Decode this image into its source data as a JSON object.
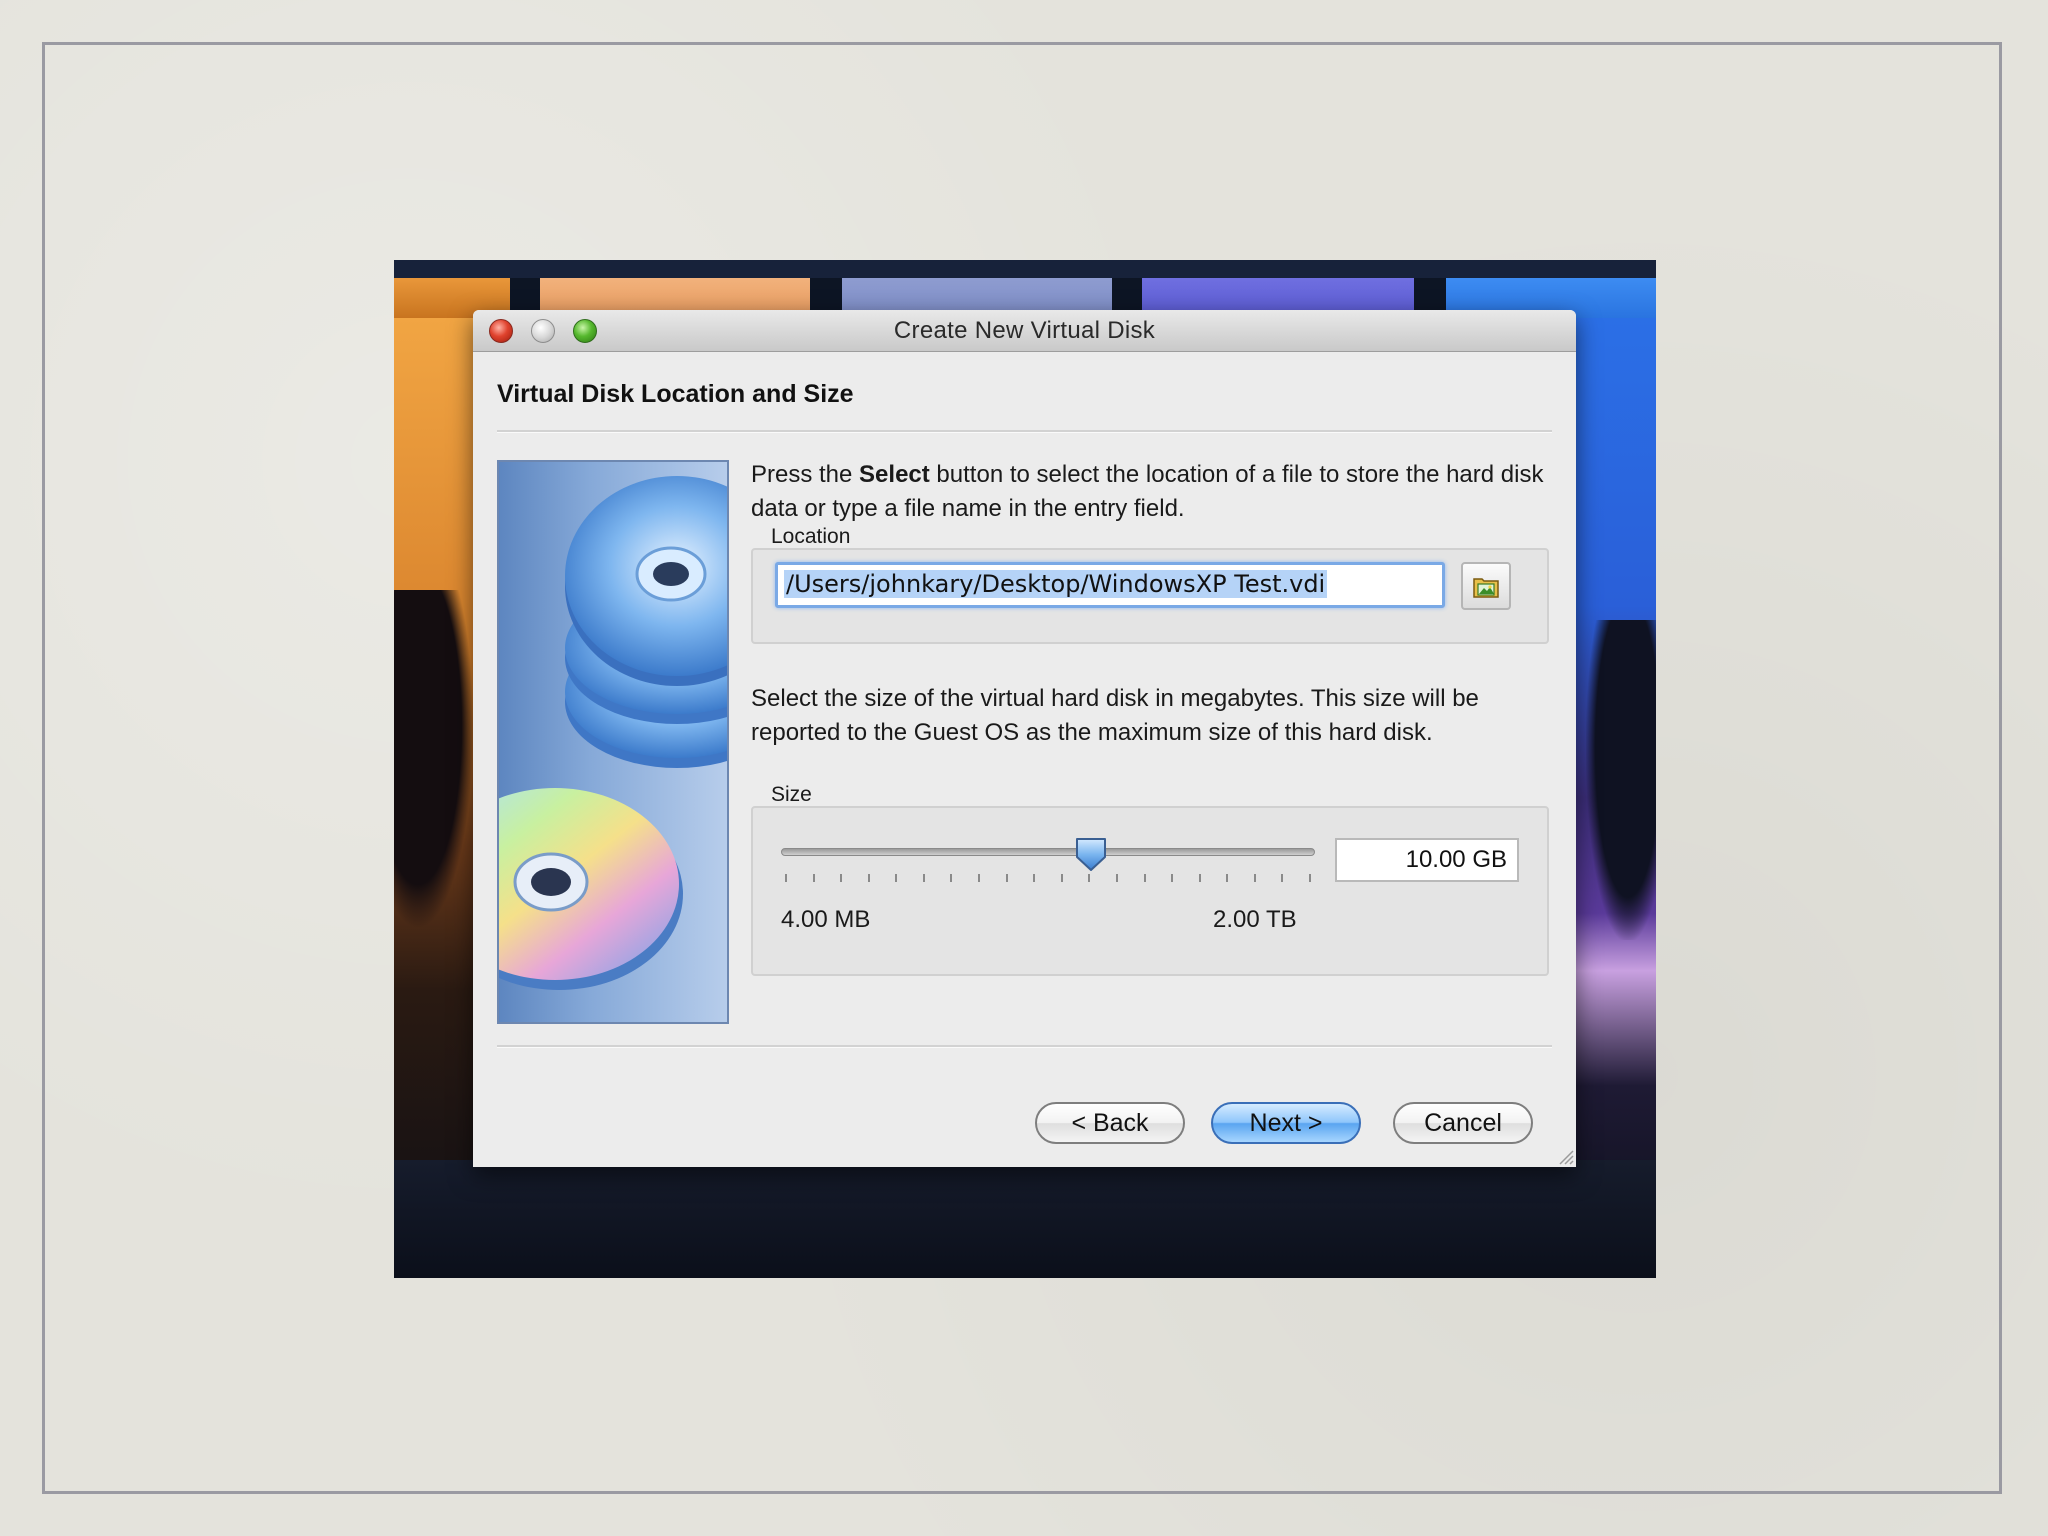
{
  "window": {
    "title": "Create New Virtual Disk"
  },
  "page": {
    "title": "Virtual Disk Location and Size"
  },
  "location": {
    "instruction_pre": "Press the ",
    "instruction_bold": "Select",
    "instruction_post": " button to select the location of a file to store the hard disk data or type a file name in the entry field.",
    "group_label": "Location",
    "path_value": "/Users/johnkary/Desktop/WindowsXP Test.vdi",
    "select_button_icon": "folder-image-icon"
  },
  "size": {
    "instruction": "Select the size of the virtual hard disk in megabytes. This size will be reported to the Guest OS as the maximum size of this hard disk.",
    "group_label": "Size",
    "value_text": "10.00 GB",
    "slider_position": 0.58,
    "min_label": "4.00 MB",
    "max_label": "2.00 TB",
    "tick_count": 20
  },
  "buttons": {
    "back": "< Back",
    "next": "Next >",
    "cancel": "Cancel"
  },
  "colors": {
    "accent": "#5aa5f0",
    "close": "#e0432e",
    "maximize": "#56b82e"
  }
}
